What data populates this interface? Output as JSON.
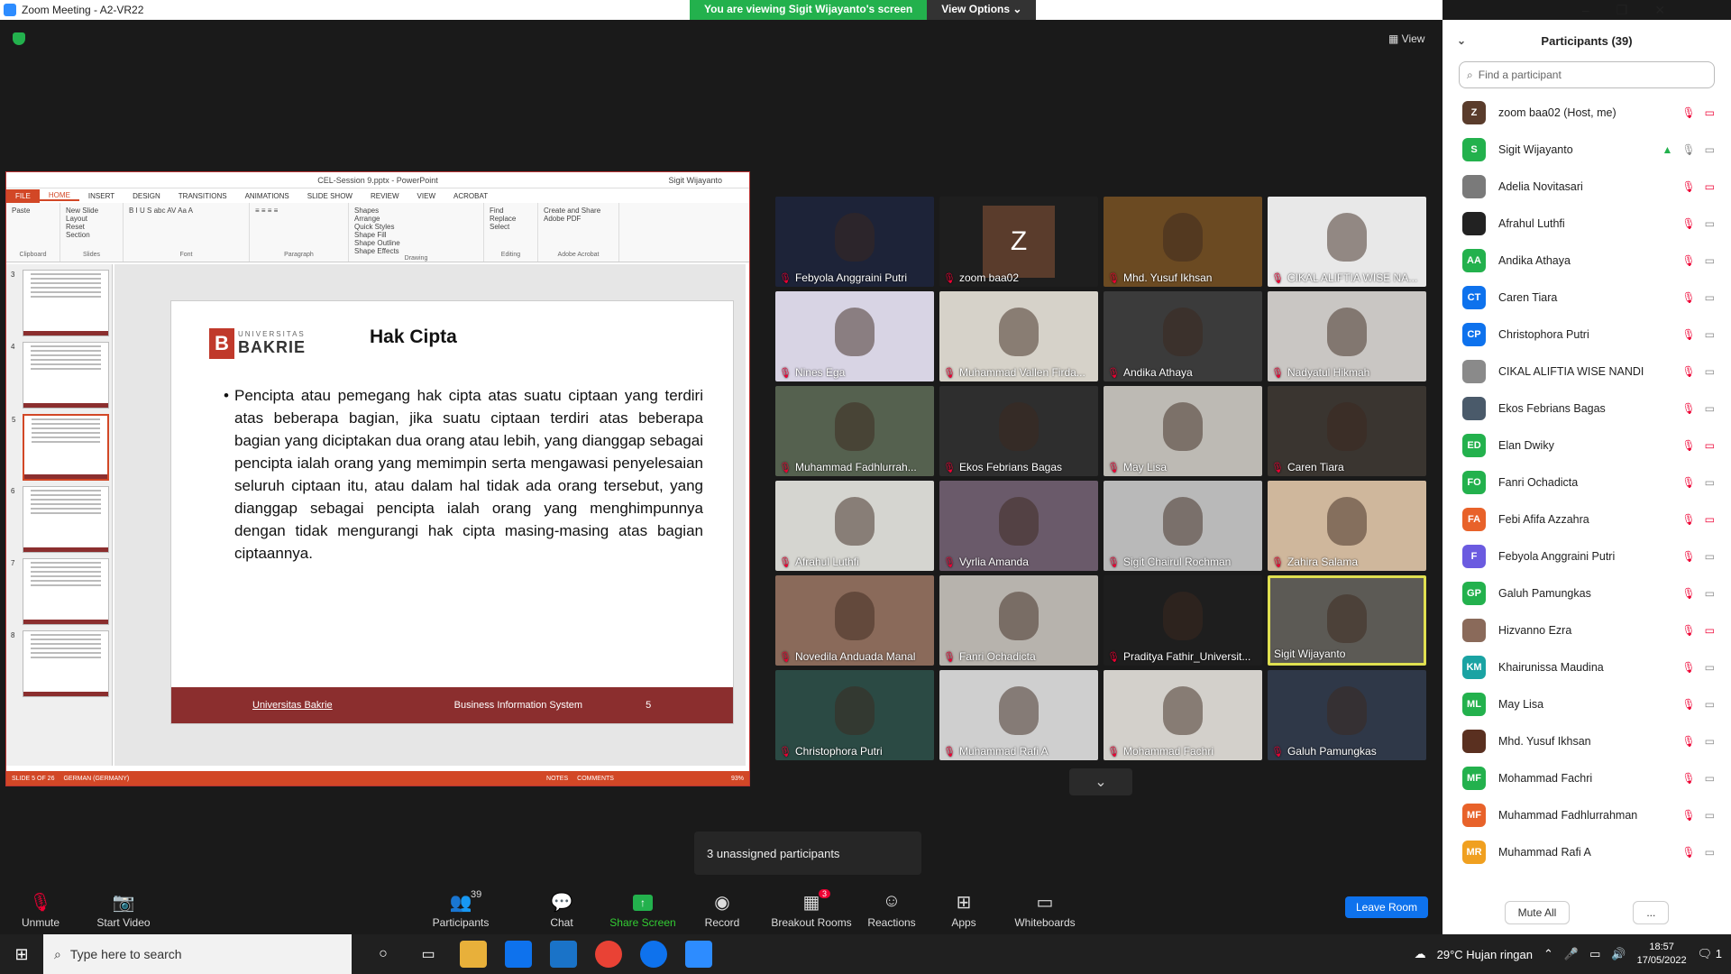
{
  "window": {
    "title": "Zoom Meeting - A2-VR22",
    "min": "–",
    "max": "❐",
    "close": "✕"
  },
  "share_banner": {
    "viewing": "You are viewing Sigit Wijayanto's screen",
    "options": "View Options ⌄"
  },
  "view_label": "View",
  "ppt": {
    "title": "CEL-Session 9.pptx - PowerPoint",
    "user": "Sigit Wijayanto",
    "tabs": [
      "FILE",
      "HOME",
      "INSERT",
      "DESIGN",
      "TRANSITIONS",
      "ANIMATIONS",
      "SLIDE SHOW",
      "REVIEW",
      "VIEW",
      "ACROBAT"
    ],
    "ribbon_groups": [
      {
        "items": [
          "Paste"
        ],
        "label": "Clipboard"
      },
      {
        "items": [
          "New Slide",
          "Layout",
          "Reset",
          "Section"
        ],
        "label": "Slides"
      },
      {
        "items": [
          "B I U S abc AV Aa A"
        ],
        "label": "Font"
      },
      {
        "items": [
          "≡ ≡ ≡ ≡"
        ],
        "label": "Paragraph"
      },
      {
        "items": [
          "Shapes",
          "Arrange",
          "Quick Styles",
          "Shape Fill",
          "Shape Outline",
          "Shape Effects"
        ],
        "label": "Drawing"
      },
      {
        "items": [
          "Find",
          "Replace",
          "Select"
        ],
        "label": "Editing"
      },
      {
        "items": [
          "Create and Share Adobe PDF"
        ],
        "label": "Adobe Acrobat"
      }
    ],
    "thumb_numbers": [
      "3",
      "4",
      "5",
      "6",
      "7",
      "8"
    ],
    "slide": {
      "logo_top": "UNIVERSITAS",
      "logo_main": "BAKRIE",
      "title": "Hak Cipta",
      "body": "Pencipta atau pemegang hak cipta atas suatu ciptaan yang terdiri atas beberapa bagian, jika suatu ciptaan terdiri atas beberapa bagian yang diciptakan dua orang atau lebih, yang dianggap sebagai pencipta ialah orang yang memimpin serta mengawasi penyelesaian seluruh ciptaan itu, atau dalam hal tidak ada orang tersebut, yang dianggap sebagai pencipta ialah orang yang menghimpunnya dengan tidak mengurangi hak cipta masing-masing atas bagian ciptaannya.",
      "footer_left": "Universitas Bakrie",
      "footer_center": "Business Information System",
      "footer_page": "5"
    },
    "status": {
      "slide": "SLIDE 5 OF 26",
      "lang": "GERMAN (GERMANY)",
      "notes": "NOTES",
      "comments": "COMMENTS",
      "zoom": "93%"
    }
  },
  "tiles": [
    {
      "name": "Febyola Anggraini Putri",
      "bg": "#1d2338"
    },
    {
      "name": "zoom baa02",
      "bg": "#1e1e1e",
      "letter": "Z"
    },
    {
      "name": "Mhd. Yusuf Ikhsan",
      "bg": "#6b4a22"
    },
    {
      "name": "CIKAL ALIFTIA WISE NA...",
      "bg": "#e8e8e8"
    },
    {
      "name": "Nines Ega",
      "bg": "#d8d4e4"
    },
    {
      "name": "Muhammad Vallen Firda...",
      "bg": "#d6d2c9"
    },
    {
      "name": "Andika Athaya",
      "bg": "#3b3b3b"
    },
    {
      "name": "Nadyatul Hikmah",
      "bg": "#c9c6c3"
    },
    {
      "name": "Muhammad Fadhlurrah...",
      "bg": "#55614f"
    },
    {
      "name": "Ekos Febrians Bagas",
      "bg": "#2e2e2e"
    },
    {
      "name": "May Lisa",
      "bg": "#bdbab4"
    },
    {
      "name": "Caren Tiara",
      "bg": "#3a3530"
    },
    {
      "name": "Afrahul Luthfi",
      "bg": "#d5d5d0"
    },
    {
      "name": "Vyrlia Amanda",
      "bg": "#6a5a6a"
    },
    {
      "name": "Sigit Chairul Rochman",
      "bg": "#b9b9b9"
    },
    {
      "name": "Zahira Salama",
      "bg": "#cfb79c"
    },
    {
      "name": "Novedila Anduada Manal",
      "bg": "#8a6a5a"
    },
    {
      "name": "Fanri Ochadicta",
      "bg": "#b7b3ad"
    },
    {
      "name": "Praditya Fathir_Universit...",
      "bg": "#1e1e1e"
    },
    {
      "name": "Sigit Wijayanto",
      "bg": "#5c5a55",
      "speaking": true
    },
    {
      "name": "Christophora Putri",
      "bg": "#2b4a44"
    },
    {
      "name": "Muhammad Rafi A",
      "bg": "#cfcfcf"
    },
    {
      "name": "Mohammad Fachri",
      "bg": "#d3d0cb"
    },
    {
      "name": "Galuh Pamungkas",
      "bg": "#2f3848"
    }
  ],
  "unassigned": "3 unassigned participants",
  "panel": {
    "title": "Participants (39)",
    "search_placeholder": "Find a participant",
    "mute_all": "Mute All",
    "more": "...",
    "participants": [
      {
        "initials": "Z",
        "color": "#5a3c2c",
        "name": "zoom baa02 (Host, me)",
        "cam_off": true
      },
      {
        "initials": "S",
        "color": "#23b14d",
        "name": "Sigit Wijayanto",
        "sharing": true,
        "mic_on": true
      },
      {
        "initials": "",
        "color": "#7a7a7a",
        "name": "Adelia Novitasari",
        "cam_off": true
      },
      {
        "initials": "",
        "color": "#222222",
        "name": "Afrahul Luthfi"
      },
      {
        "initials": "AA",
        "color": "#23b14d",
        "name": "Andika Athaya"
      },
      {
        "initials": "CT",
        "color": "#0e72ed",
        "name": "Caren Tiara"
      },
      {
        "initials": "CP",
        "color": "#0e72ed",
        "name": "Christophora Putri"
      },
      {
        "initials": "",
        "color": "#8a8a8a",
        "name": "CIKAL ALIFTIA WISE NANDI"
      },
      {
        "initials": "",
        "color": "#4a5a6a",
        "name": "Ekos Febrians Bagas"
      },
      {
        "initials": "ED",
        "color": "#23b14d",
        "name": "Elan Dwiky",
        "cam_off": true
      },
      {
        "initials": "FO",
        "color": "#23b14d",
        "name": "Fanri Ochadicta"
      },
      {
        "initials": "FA",
        "color": "#e8622a",
        "name": "Febi Afifa Azzahra",
        "cam_off": true
      },
      {
        "initials": "F",
        "color": "#6b5be0",
        "name": "Febyola Anggraini Putri"
      },
      {
        "initials": "GP",
        "color": "#23b14d",
        "name": "Galuh Pamungkas"
      },
      {
        "initials": "",
        "color": "#8a6a5a",
        "name": "Hizvanno Ezra",
        "cam_off": true
      },
      {
        "initials": "KM",
        "color": "#1aa3a3",
        "name": "Khairunissa Maudina"
      },
      {
        "initials": "ML",
        "color": "#23b14d",
        "name": "May Lisa"
      },
      {
        "initials": "",
        "color": "#5a3020",
        "name": "Mhd. Yusuf Ikhsan"
      },
      {
        "initials": "MF",
        "color": "#23b14d",
        "name": "Mohammad Fachri"
      },
      {
        "initials": "MF",
        "color": "#e8622a",
        "name": "Muhammad Fadhlurrahman"
      },
      {
        "initials": "MR",
        "color": "#f0a020",
        "name": "Muhammad Rafi A"
      }
    ]
  },
  "toolbar": {
    "unmute": "Unmute",
    "start_video": "Start Video",
    "participants": "Participants",
    "participants_count": "39",
    "chat": "Chat",
    "share": "Share Screen",
    "record": "Record",
    "breakout": "Breakout Rooms",
    "breakout_badge": "3",
    "reactions": "Reactions",
    "apps": "Apps",
    "whiteboards": "Whiteboards",
    "leave": "Leave Room"
  },
  "taskbar": {
    "search": "Type here to search",
    "weather": "29°C  Hujan ringan",
    "time": "18:57",
    "date": "17/05/2022",
    "notif": "1"
  }
}
